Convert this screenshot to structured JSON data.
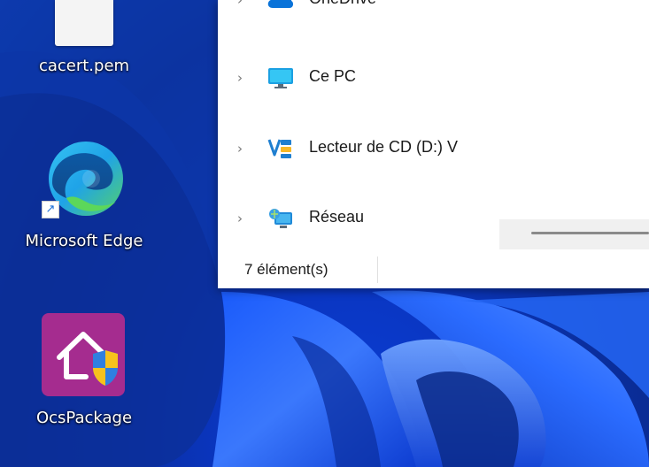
{
  "desktop": {
    "icons": [
      {
        "label": "cacert.pem"
      },
      {
        "label": "Microsoft Edge"
      },
      {
        "label": "OcsPackage"
      }
    ]
  },
  "explorer": {
    "nav_items": [
      {
        "label": "OneDrive"
      },
      {
        "label": "Ce PC"
      },
      {
        "label": "Lecteur de CD (D:) V"
      },
      {
        "label": "Réseau"
      }
    ],
    "status": {
      "item_count": "7 élément(s)"
    }
  },
  "colors": {
    "wallpaper": "#0a2e9e",
    "accent": "#0078d4",
    "window_bg": "#ffffff"
  }
}
